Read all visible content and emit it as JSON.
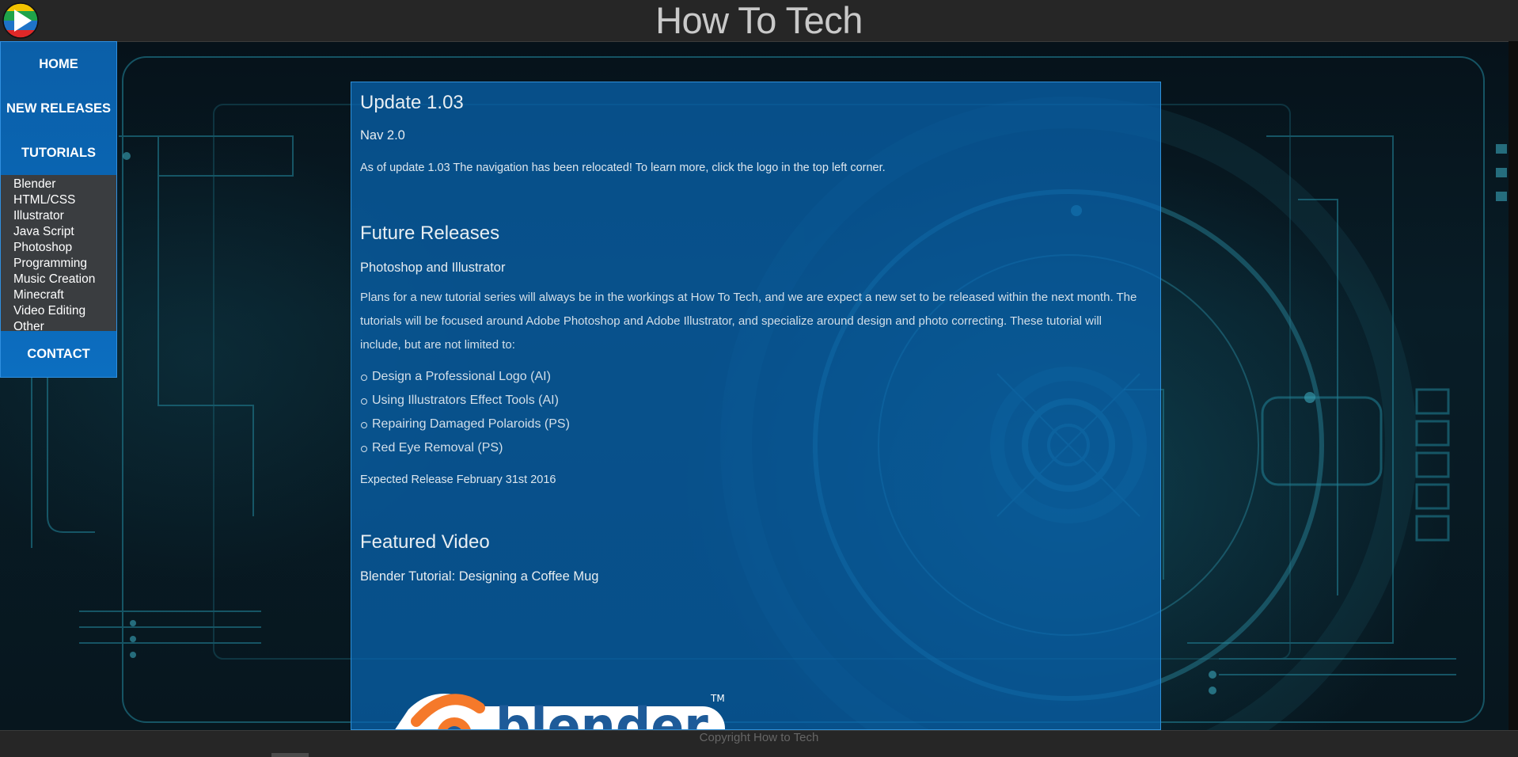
{
  "header": {
    "title": "How To Tech",
    "logo_icon": "play-logo-icon"
  },
  "nav": {
    "home": "HOME",
    "new_releases": "NEW RELEASES",
    "tutorials": "TUTORIALS",
    "tutorial_items": [
      "Blender",
      "HTML/CSS",
      "Illustrator",
      "Java Script",
      "Photoshop",
      "Programming",
      "Music Creation",
      "Minecraft",
      "Video Editing",
      "Other"
    ],
    "contact": "CONTACT"
  },
  "main": {
    "update": {
      "title": "Update 1.03",
      "subtitle": "Nav 2.0",
      "text": "As of update 1.03 The navigation has been relocated! To learn more, click the logo in the top left corner."
    },
    "future": {
      "title": "Future Releases",
      "subtitle": "Photoshop and Illustrator",
      "paragraph": "Plans for a new tutorial series will always be in the workings at How To Tech, and we are expect a new set to be released within the next month. The tutorials will be focused around Adobe Photoshop and Adobe Illustrator, and specialize around design and photo correcting. These tutorial will include, but are not limited to:",
      "items": [
        "Design a Professional Logo (AI)",
        "Using Illustrators Effect Tools (AI)",
        "Repairing Damaged Polaroids (PS)",
        "Red Eye Removal (PS)"
      ],
      "release": "Expected Release February 31st 2016"
    },
    "featured": {
      "title": "Featured Video",
      "subtitle": "Blender Tutorial: Designing a Coffee Mug",
      "logo_text": "blender",
      "logo_tm": "TM"
    }
  },
  "footer": {
    "copyright": "Copyright How to Tech"
  },
  "colors": {
    "header_bg": "#262626",
    "nav_bg": "#0a67b6",
    "panel_bg": "#0864af",
    "submenu_bg": "#3a3d40",
    "blender_orange": "#f5792a"
  }
}
